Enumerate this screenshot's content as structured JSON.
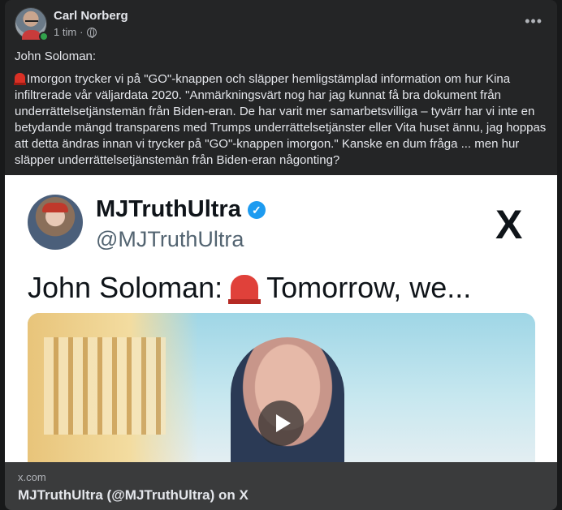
{
  "post": {
    "author": "Carl Norberg",
    "time": "1 tim",
    "separator": "·",
    "more_label": "•••",
    "text_line1": "John Soloman:",
    "text_line2": "Imorgon trycker vi på \"GO\"-knappen och släpper hemligstämplad information om hur Kina infiltrerade vår väljardata 2020. \"Anmärkningsvärt nog har jag kunnat få bra dokument från underrättelsetjänstemän från Biden-eran. De har varit mer samarbetsvilliga – tyvärr har vi inte en betydande mängd transparens med Trumps underrättelsetjänster eller Vita huset ännu, jag hoppas att detta ändras innan vi trycker på \"GO\"-knappen imorgon.\" Kanske en dum fråga ... men hur släpper underrättelsetjänstemän från Biden-eran någonting?"
  },
  "media": {
    "name": "MJTruthUltra",
    "handle": "@MJTruthUltra",
    "x_logo": "X",
    "verified": "✓",
    "text_before": "John Soloman:",
    "text_after": "Tomorrow, we..."
  },
  "link": {
    "domain": "x.com",
    "title": "MJTruthUltra (@MJTruthUltra) on X"
  },
  "icons": {
    "avatar": "avatar",
    "globe": "globe-icon",
    "siren": "siren-icon",
    "play": "play-icon",
    "x": "x-logo-icon",
    "verified": "verified-badge-icon"
  },
  "colors": {
    "background": "#18191a",
    "card": "#242526",
    "link_bar": "#3a3b3c",
    "online": "#31a24c",
    "verified": "#1d9bf0"
  }
}
